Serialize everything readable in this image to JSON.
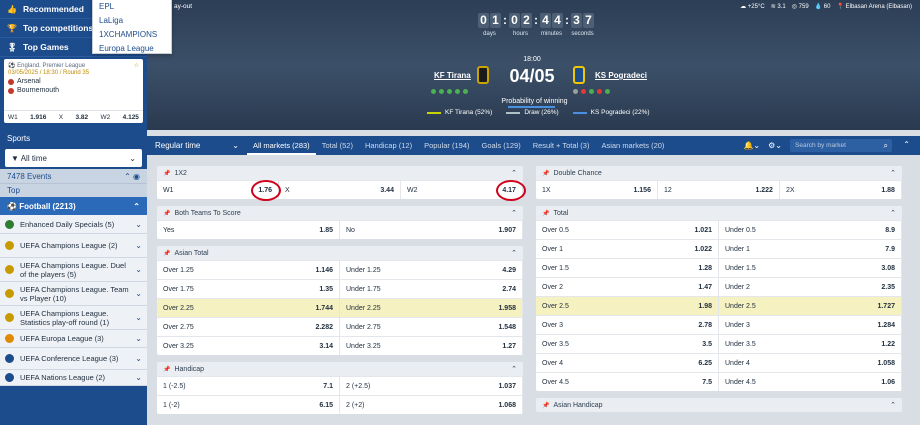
{
  "sidebar_top": {
    "recommended": "Recommended",
    "top_competitions": "Top competitions",
    "top_games": "Top Games"
  },
  "dropdown": [
    "EPL",
    "LaLiga",
    "1XCHAMPIONS",
    "Europa League"
  ],
  "match_card": {
    "league": "England. Premier League",
    "datetime": "03/05/2025 / 18:30 / Round 35",
    "team1": "Arsenal",
    "team2": "Bournemouth",
    "w1_label": "W1",
    "w1": "1.916",
    "x_label": "X",
    "x": "3.82",
    "w2_label": "W2",
    "w2": "4.125"
  },
  "sports": {
    "header": "Sports",
    "filter": "All time",
    "events": "7478 Events",
    "top": "Top",
    "football": "Football (2213)",
    "items": [
      {
        "label": "Enhanced Daily Specials (5)",
        "icon_color": "#2e7d32"
      },
      {
        "label": "UEFA Champions League (2)",
        "icon_color": "#c79a00"
      },
      {
        "label": "UEFA Champions League. Duel of the players (5)",
        "icon_color": "#c79a00"
      },
      {
        "label": "UEFA Champions League. Team vs Player (10)",
        "icon_color": "#c79a00"
      },
      {
        "label": "UEFA Champions League. Statistics play-off round (1)",
        "icon_color": "#c79a00"
      },
      {
        "label": "UEFA Europa League (3)",
        "icon_color": "#e08a00"
      },
      {
        "label": "UEFA Conference League (3)",
        "icon_color": "#1d4c8c"
      },
      {
        "label": "UEFA Nations League (2)",
        "icon_color": "#1d4c8c"
      }
    ]
  },
  "hero": {
    "payout": "ay-out",
    "weather": [
      "+25°C",
      "3.1",
      "759",
      "60",
      "Elbasan Arena (Elbasan)"
    ],
    "countdown": {
      "days": [
        "0",
        "1"
      ],
      "hours": [
        "0",
        "2"
      ],
      "minutes": [
        "4",
        "4"
      ],
      "seconds": [
        "3",
        "7"
      ],
      "labels": [
        "days",
        "hours",
        "minutes",
        "seconds"
      ]
    },
    "kickoff": "18:00",
    "score": "04/05",
    "team_home": "KF Tirana",
    "team_away": "KS Pogradeci",
    "probability_title": "Probability of winning",
    "legend": [
      "KF Tirana (52%)",
      "Draw (26%)",
      "KS Pogradeci (22%)"
    ]
  },
  "toolbar": {
    "regular_time": "Regular time",
    "tabs": [
      "All markets (283)",
      "Total (52)",
      "Handicap (12)",
      "Popular (194)",
      "Goals (129)",
      "Result + Total (3)",
      "Asian markets (20)"
    ],
    "search_placeholder": "Search by market"
  },
  "markets_left": {
    "m1x2": {
      "title": "1X2",
      "cells": [
        [
          "W1",
          "1.76"
        ],
        [
          "X",
          "3.44"
        ],
        [
          "W2",
          "4.17"
        ]
      ]
    },
    "btts": {
      "title": "Both Teams To Score",
      "cells": [
        [
          "Yes",
          "1.85"
        ],
        [
          "No",
          "1.907"
        ]
      ]
    },
    "asian_total": {
      "title": "Asian Total",
      "cells": [
        [
          "Over 1.25",
          "1.146"
        ],
        [
          "Under 1.25",
          "4.29"
        ],
        [
          "Over 1.75",
          "1.35"
        ],
        [
          "Under 1.75",
          "2.74"
        ],
        [
          "Over 2.25",
          "1.744"
        ],
        [
          "Under 2.25",
          "1.958"
        ],
        [
          "Over 2.75",
          "2.282"
        ],
        [
          "Under 2.75",
          "1.548"
        ],
        [
          "Over 3.25",
          "3.14"
        ],
        [
          "Under 3.25",
          "1.27"
        ]
      ]
    },
    "handicap": {
      "title": "Handicap",
      "cells": [
        [
          "1 (-2.5)",
          "7.1"
        ],
        [
          "2 (+2.5)",
          "1.037"
        ],
        [
          "1 (-2)",
          "6.15"
        ],
        [
          "2 (+2)",
          "1.068"
        ]
      ]
    }
  },
  "markets_right": {
    "double_chance": {
      "title": "Double Chance",
      "cells": [
        [
          "1X",
          "1.156"
        ],
        [
          "12",
          "1.222"
        ],
        [
          "2X",
          "1.88"
        ]
      ]
    },
    "total": {
      "title": "Total",
      "cells": [
        [
          "Over 0.5",
          "1.021"
        ],
        [
          "Under 0.5",
          "8.9"
        ],
        [
          "Over 1",
          "1.022"
        ],
        [
          "Under 1",
          "7.9"
        ],
        [
          "Over 1.5",
          "1.28"
        ],
        [
          "Under 1.5",
          "3.08"
        ],
        [
          "Over 2",
          "1.47"
        ],
        [
          "Under 2",
          "2.35"
        ],
        [
          "Over 2.5",
          "1.98"
        ],
        [
          "Under 2.5",
          "1.727"
        ],
        [
          "Over 3",
          "2.78"
        ],
        [
          "Under 3",
          "1.284"
        ],
        [
          "Over 3.5",
          "3.5"
        ],
        [
          "Under 3.5",
          "1.22"
        ],
        [
          "Over 4",
          "6.25"
        ],
        [
          "Under 4",
          "1.058"
        ],
        [
          "Over 4.5",
          "7.5"
        ],
        [
          "Under 4.5",
          "1.06"
        ]
      ]
    },
    "asian_handicap": {
      "title": "Asian Handicap"
    }
  }
}
